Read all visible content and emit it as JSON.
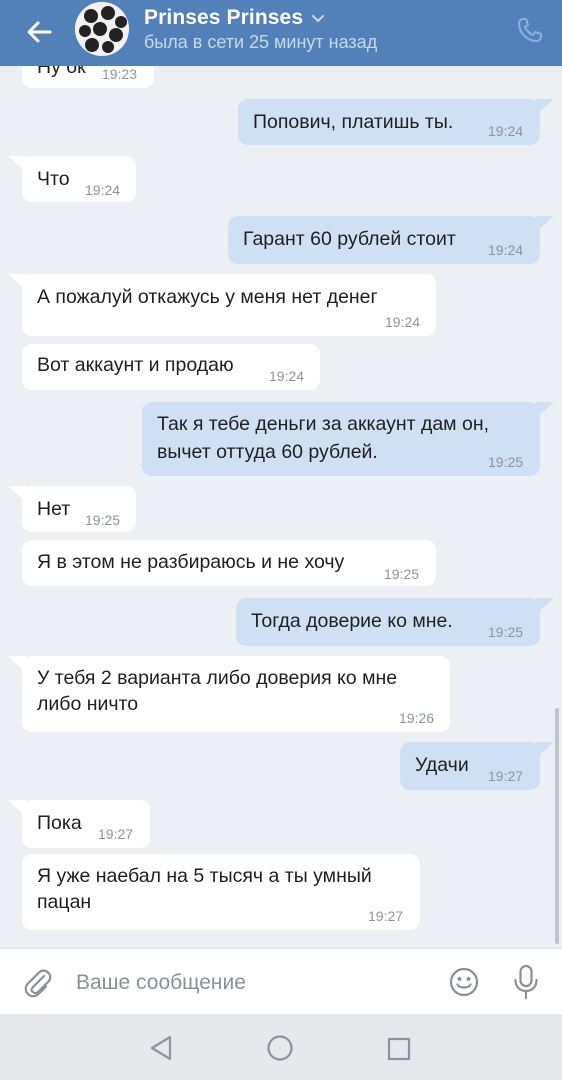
{
  "header": {
    "contact_name": "Prinses Prinses",
    "status": "была в сети 25 минут назад"
  },
  "messages": [
    {
      "dir": "in",
      "lines": [
        "Ну ок"
      ],
      "time": "19:23"
    },
    {
      "dir": "out",
      "lines": [
        "Попович, платишь ты."
      ],
      "time": "19:24"
    },
    {
      "dir": "in",
      "lines": [
        "Что"
      ],
      "time": "19:24"
    },
    {
      "dir": "out",
      "lines": [
        "Гарант 60 рублей стоит"
      ],
      "time": "19:24"
    },
    {
      "dir": "in",
      "lines": [
        "А пожалуй откажусь у меня нет  денег"
      ],
      "time": "19:24"
    },
    {
      "dir": "in",
      "lines": [
        "Вот аккаунт и продаю"
      ],
      "time": "19:24"
    },
    {
      "dir": "out",
      "lines": [
        "Так я тебе деньги за аккаунт дам он,",
        "вычет оттуда 60 рублей."
      ],
      "time": "19:25"
    },
    {
      "dir": "in",
      "lines": [
        "Нет"
      ],
      "time": "19:25"
    },
    {
      "dir": "in",
      "lines": [
        "Я в этом не разбираюсь и не хочу"
      ],
      "time": "19:25"
    },
    {
      "dir": "out",
      "lines": [
        "Тогда доверие ко мне."
      ],
      "time": "19:25"
    },
    {
      "dir": "in",
      "lines": [
        "У тебя 2 варианта либо доверия ко мне",
        "либо ничто"
      ],
      "time": "19:26"
    },
    {
      "dir": "out",
      "lines": [
        "Удачи"
      ],
      "time": "19:27"
    },
    {
      "dir": "in",
      "lines": [
        "Пока"
      ],
      "time": "19:27"
    },
    {
      "dir": "in",
      "lines": [
        "Я уже наебал на 5 тысяч а ты умный",
        "пацан"
      ],
      "time": "19:27"
    }
  ],
  "composer": {
    "placeholder": "Ваше сообщение"
  },
  "icons": {
    "back": "arrow-left-icon",
    "chevron": "chevron-down-icon",
    "call": "phone-icon",
    "attach": "paperclip-icon",
    "emoji": "smile-icon",
    "voice": "microphone-icon",
    "nav_back": "triangle-back-icon",
    "nav_home": "circle-home-icon",
    "nav_recent": "square-recent-icon"
  },
  "colors": {
    "header": "#5181b8",
    "incoming_bubble": "#ffffff",
    "outgoing_bubble": "#cfe0f5",
    "chat_background": "#eceff3"
  }
}
